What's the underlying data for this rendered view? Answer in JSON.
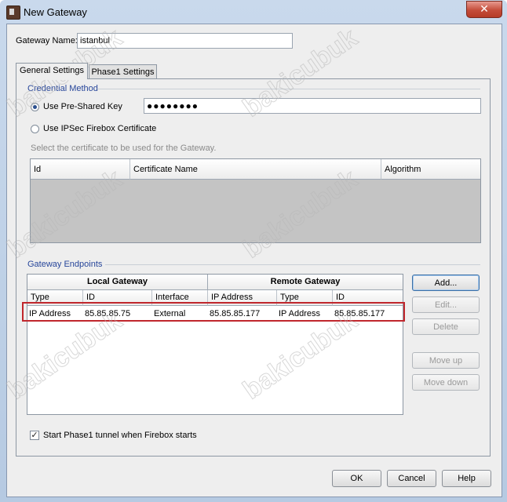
{
  "window": {
    "title": "New Gateway",
    "close_glyph": "✕"
  },
  "gateway_name": {
    "label": "Gateway Name:",
    "value": "istanbul"
  },
  "tabs": [
    {
      "label": "General Settings",
      "active": true
    },
    {
      "label": "Phase1 Settings",
      "active": false
    }
  ],
  "credential": {
    "group_title": "Credential Method",
    "psk_label": "Use Pre-Shared Key",
    "psk_value": "●●●●●●●●",
    "cert_label": "Use IPSec Firebox Certificate",
    "cert_hint": "Select the certificate to be used for the Gateway.",
    "cert_columns": [
      "Id",
      "Certificate Name",
      "Algorithm"
    ]
  },
  "endpoints": {
    "group_title": "Gateway Endpoints",
    "local_header": "Local Gateway",
    "remote_header": "Remote Gateway",
    "columns": [
      "Type",
      "ID",
      "Interface",
      "IP Address",
      "Type",
      "ID"
    ],
    "rows": [
      [
        "IP Address",
        "85.85.85.75",
        "External",
        "85.85.85.177",
        "IP Address",
        "85.85.85.177"
      ]
    ],
    "buttons": {
      "add": "Add...",
      "edit": "Edit...",
      "delete": "Delete",
      "move_up": "Move up",
      "move_down": "Move down"
    }
  },
  "start_phase1": {
    "label": "Start Phase1 tunnel when Firebox starts",
    "checked": true,
    "check_glyph": "✓"
  },
  "footer": {
    "ok": "OK",
    "cancel": "Cancel",
    "help": "Help"
  },
  "watermark": "bakicubuk",
  "colors": {
    "group_title": "#27469a",
    "highlight": "#c0272d",
    "close": "#c44c3a"
  }
}
